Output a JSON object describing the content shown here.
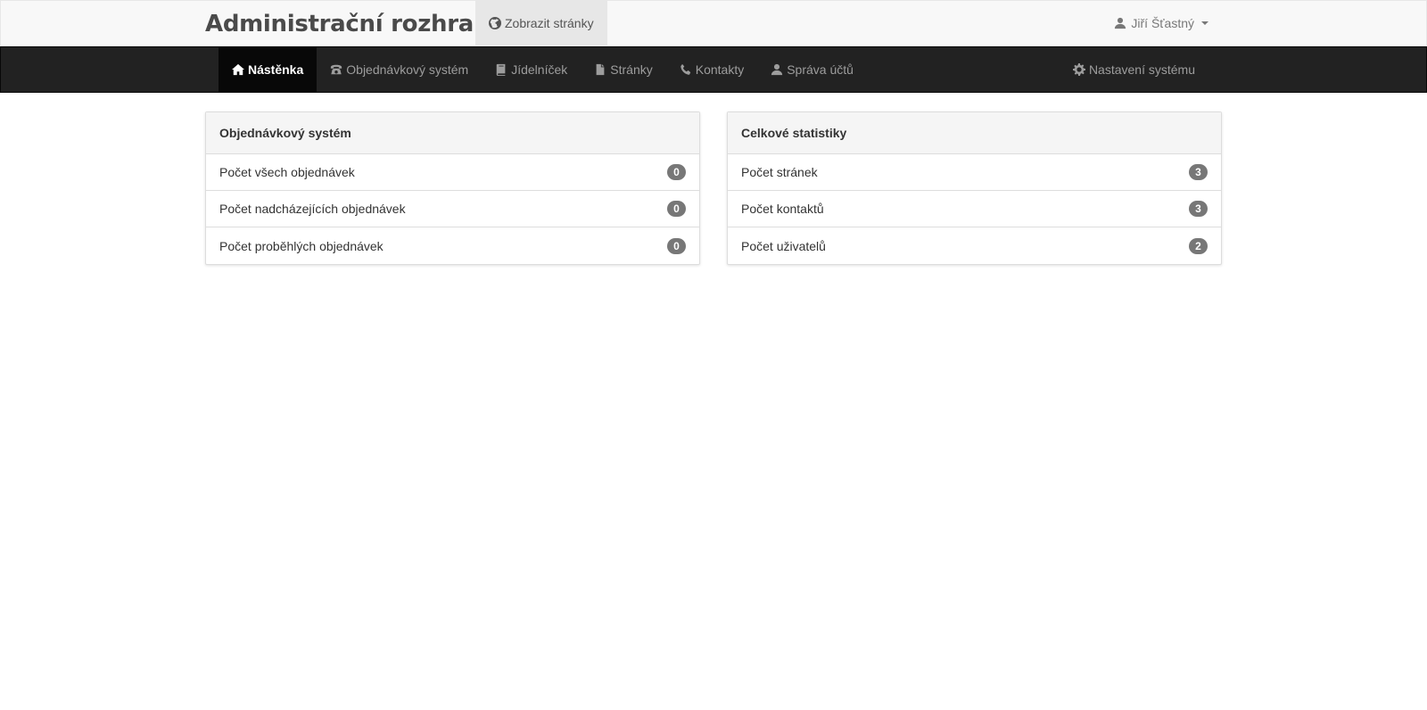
{
  "header": {
    "brand": "Administrační rozhraní",
    "view_site_label": "Zobrazit stránky",
    "user_name": "Jiří Šťastný"
  },
  "nav": {
    "items": [
      {
        "label": "Nástěnka",
        "icon": "home-icon",
        "active": true
      },
      {
        "label": "Objednávkový systém",
        "icon": "phone-alt-icon"
      },
      {
        "label": "Jídelníček",
        "icon": "book-icon"
      },
      {
        "label": "Stránky",
        "icon": "file-icon"
      },
      {
        "label": "Kontakty",
        "icon": "earphone-icon"
      },
      {
        "label": "Správa účtů",
        "icon": "user-icon"
      }
    ],
    "settings_label": "Nastavení systému"
  },
  "panels": {
    "orders": {
      "title": "Objednávkový systém",
      "items": [
        {
          "label": "Počet všech objednávek",
          "count": "0"
        },
        {
          "label": "Počet nadcházejících objednávek",
          "count": "0"
        },
        {
          "label": "Počet proběhlých objednávek",
          "count": "0"
        }
      ]
    },
    "stats": {
      "title": "Celkové statistiky",
      "items": [
        {
          "label": "Počet stránek",
          "count": "3"
        },
        {
          "label": "Počet kontaktů",
          "count": "3"
        },
        {
          "label": "Počet uživatelů",
          "count": "2"
        }
      ]
    }
  },
  "colors": {
    "navbar_bg": "#222222",
    "nav_active_bg": "#080808",
    "badge_bg": "#777777",
    "topbar_bg": "#f8f8f8"
  }
}
